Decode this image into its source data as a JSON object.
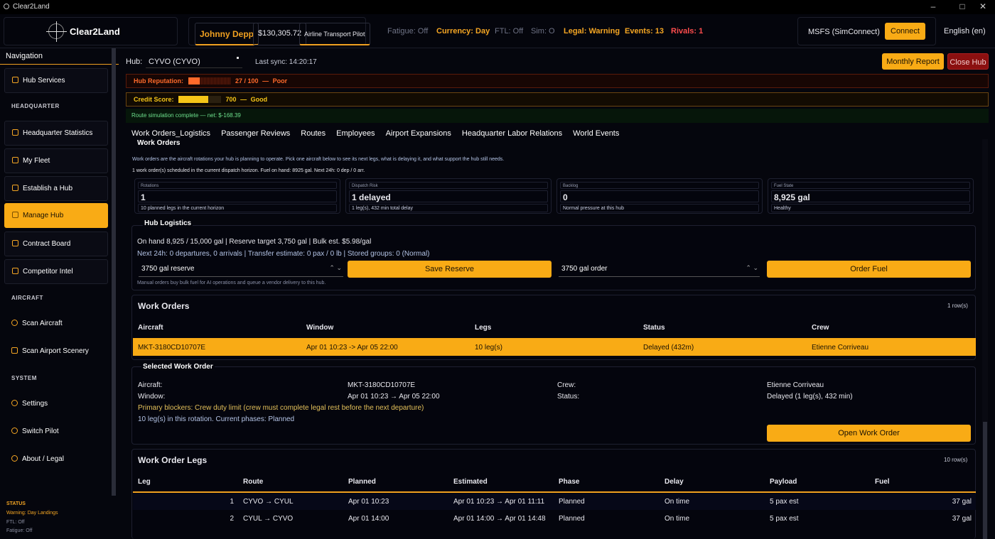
{
  "window": {
    "title": "Clear2Land",
    "controls": [
      "–",
      "□",
      "✕"
    ]
  },
  "brand": {
    "name": "Clear2Land"
  },
  "pilot": {
    "name": "Johnny Depp",
    "balance": "$130,305.72",
    "rank": "Airline Transport Pilot"
  },
  "status_bar": {
    "fatigue": "Fatigue: Off",
    "currency": "Currency: Day",
    "ftl": "FTL: Off",
    "sim": "Sim: O",
    "legal": "Legal: Warning",
    "events": "Events: 13",
    "rivals": "Rivals: 1"
  },
  "sim_connect": {
    "label": "MSFS (SimConnect)",
    "button": "Connect"
  },
  "language": {
    "label": "English (en)"
  },
  "nav": {
    "title": "Navigation",
    "sections": {
      "headquarter": "HEADQUARTER",
      "aircraft": "AIRCRAFT",
      "system": "SYSTEM"
    },
    "items": {
      "hub_services": "Hub Services",
      "hq_stats": "Headquarter Statistics",
      "my_fleet": "My Fleet",
      "establish_hub": "Establish a Hub",
      "manage_hub": "Manage Hub",
      "contract_board": "Contract Board",
      "competitor_intel": "Competitor Intel",
      "scan_aircraft": "Scan Aircraft",
      "scan_scenery": "Scan Airport Scenery",
      "settings": "Settings",
      "switch_pilot": "Switch Pilot",
      "about": "About / Legal"
    },
    "status": {
      "title": "STATUS",
      "warning": "Warning: Day Landings",
      "ftl": "FTL: Off",
      "fatigue": "Fatigue: Off"
    }
  },
  "hub": {
    "label": "Hub:",
    "value": "CYVO (CYVO)",
    "last_sync": "Last sync: 14:20:17",
    "monthly_report": "Monthly Report",
    "close_hub": "Close Hub",
    "reputation": {
      "label": "Hub Reputation:",
      "value": "27 / 100",
      "sep": "—",
      "rating": "Poor",
      "fraction": 0.27
    },
    "credit": {
      "label": "Credit Score:",
      "value": "700",
      "sep": "—",
      "rating": "Good",
      "fraction": 0.7
    },
    "sim_message": "Route simulation complete — net: $-168.39"
  },
  "tabs": [
    "Work Orders_Logistics",
    "Passenger Reviews",
    "Routes",
    "Employees",
    "Airport Expansions",
    "Headquarter Labor Relations",
    "World Events"
  ],
  "work_orders_intro": {
    "title": "Work Orders",
    "desc": "Work orders are the aircraft rotations your hub is planning to operate. Pick one aircraft below to see its next legs, what is delaying it, and what support the hub still needs.",
    "summary": "1 work order(s) scheduled in the current dispatch horizon. Fuel on hand: 8925 gal.  Next 24h: 0 dep / 0 arr."
  },
  "kpis": [
    {
      "label": "Rotations",
      "value": "1",
      "hint": "10 planned legs in the current horizon"
    },
    {
      "label": "Dispatch Risk",
      "value": "1 delayed",
      "hint": "1 leg(s), 432 min total delay"
    },
    {
      "label": "Backlog",
      "value": "0",
      "hint": "Normal pressure at this hub"
    },
    {
      "label": "Fuel State",
      "value": "8,925 gal",
      "hint": "Healthy"
    }
  ],
  "logistics": {
    "title": "Hub Logistics",
    "line1": "On hand 8,925 / 15,000 gal | Reserve target 3,750 gal | Bulk est. $5.98/gal",
    "line2": "Next 24h: 0 departures, 0 arrivals | Transfer estimate: 0 pax / 0 lb | Stored groups: 0 (Normal)",
    "reserve_select": "3750 gal reserve",
    "save_reserve": "Save Reserve",
    "order_select": "3750 gal order",
    "order_fuel": "Order Fuel",
    "note": "Manual orders buy bulk fuel for AI operations and queue a vendor delivery to this hub."
  },
  "orders_table": {
    "title": "Work Orders",
    "count": "1 row(s)",
    "headers": [
      "Aircraft",
      "Window",
      "Legs",
      "Status",
      "Crew"
    ],
    "rows": [
      [
        "MKT-3180CD10707E",
        "Apr 01 10:23 -> Apr 05 22:00",
        "10 leg(s)",
        "Delayed (432m)",
        "Etienne Corriveau"
      ]
    ]
  },
  "selected": {
    "title": "Selected Work Order",
    "aircraft_label": "Aircraft:",
    "aircraft": "MKT-3180CD10707E",
    "window_label": "Window:",
    "window": "Apr 01 10:23 → Apr 05 22:00",
    "crew_label": "Crew:",
    "crew": "Etienne Corriveau",
    "status_label": "Status:",
    "status": "Delayed (1 leg(s), 432 min)",
    "blockers": "Primary blockers: Crew duty limit (crew must complete legal rest before the next departure)",
    "phases": "10 leg(s) in this rotation. Current phases: Planned",
    "open": "Open Work Order"
  },
  "legs_table": {
    "title": "Work Order Legs",
    "count": "10 row(s)",
    "headers": [
      "Leg",
      "Route",
      "Planned",
      "Estimated",
      "Phase",
      "Delay",
      "Payload",
      "Fuel"
    ],
    "rows": [
      [
        "1",
        "CYVO → CYUL",
        "Apr 01 10:23",
        "Apr 01 10:23 → Apr 01 11:11",
        "Planned",
        "On time",
        "5 pax est",
        "37 gal"
      ],
      [
        "2",
        "CYUL → CYVO",
        "Apr 01 14:00",
        "Apr 01 14:00 → Apr 01 14:48",
        "Planned",
        "On time",
        "5 pax est",
        "37 gal"
      ]
    ]
  },
  "colors": {
    "accent": "#f9ab15",
    "danger": "#ff4d4d",
    "close_hub": "#8b1010",
    "sim_ok": "#6de08c"
  }
}
